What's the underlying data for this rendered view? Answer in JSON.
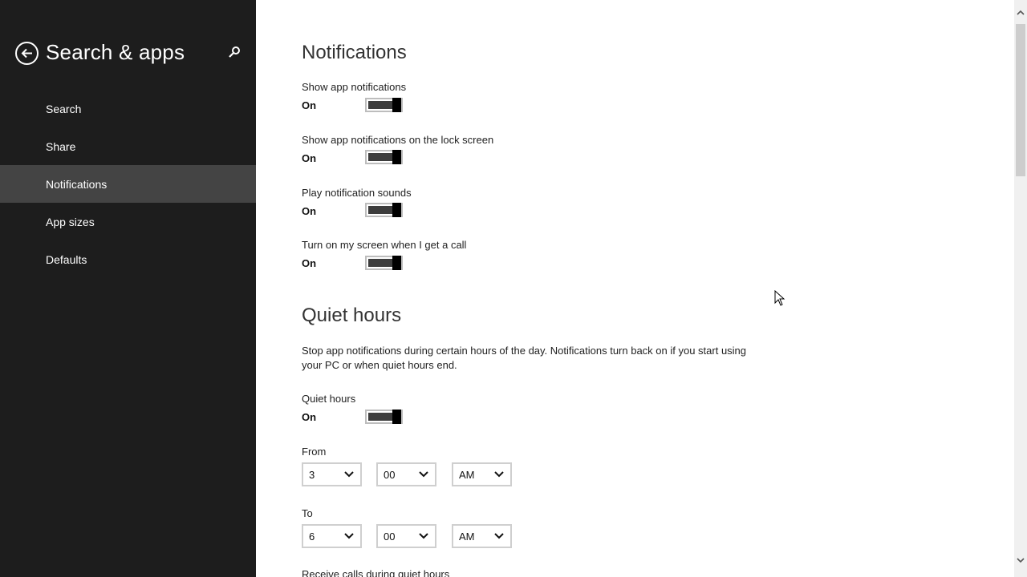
{
  "sidebar": {
    "title": "Search & apps",
    "items": [
      {
        "label": "Search"
      },
      {
        "label": "Share"
      },
      {
        "label": "Notifications"
      },
      {
        "label": "App sizes"
      },
      {
        "label": "Defaults"
      }
    ],
    "selected": "Notifications"
  },
  "notifications": {
    "title": "Notifications",
    "settings": [
      {
        "label": "Show app notifications",
        "state": "On"
      },
      {
        "label": "Show app notifications on the lock screen",
        "state": "On"
      },
      {
        "label": "Play notification sounds",
        "state": "On"
      },
      {
        "label": "Turn on my screen when I get a call",
        "state": "On"
      }
    ]
  },
  "quiet_hours": {
    "title": "Quiet hours",
    "description": "Stop app notifications during certain hours of the day. Notifications turn back on if you start using your PC or when quiet hours end.",
    "toggle": {
      "label": "Quiet hours",
      "state": "On"
    },
    "from": {
      "label": "From",
      "hour": "3",
      "minute": "00",
      "period": "AM"
    },
    "to": {
      "label": "To",
      "hour": "6",
      "minute": "00",
      "period": "AM"
    },
    "next_setting_label": "Receive calls during quiet hours"
  },
  "icons": {
    "back": "back-arrow-icon",
    "search": "search-icon",
    "dropdown": "chevron-down-icon"
  },
  "colors": {
    "sidebar_bg": "#1d1d1d",
    "selected_item_bg": "#444444",
    "toggle_fill": "#3d3d3d"
  }
}
